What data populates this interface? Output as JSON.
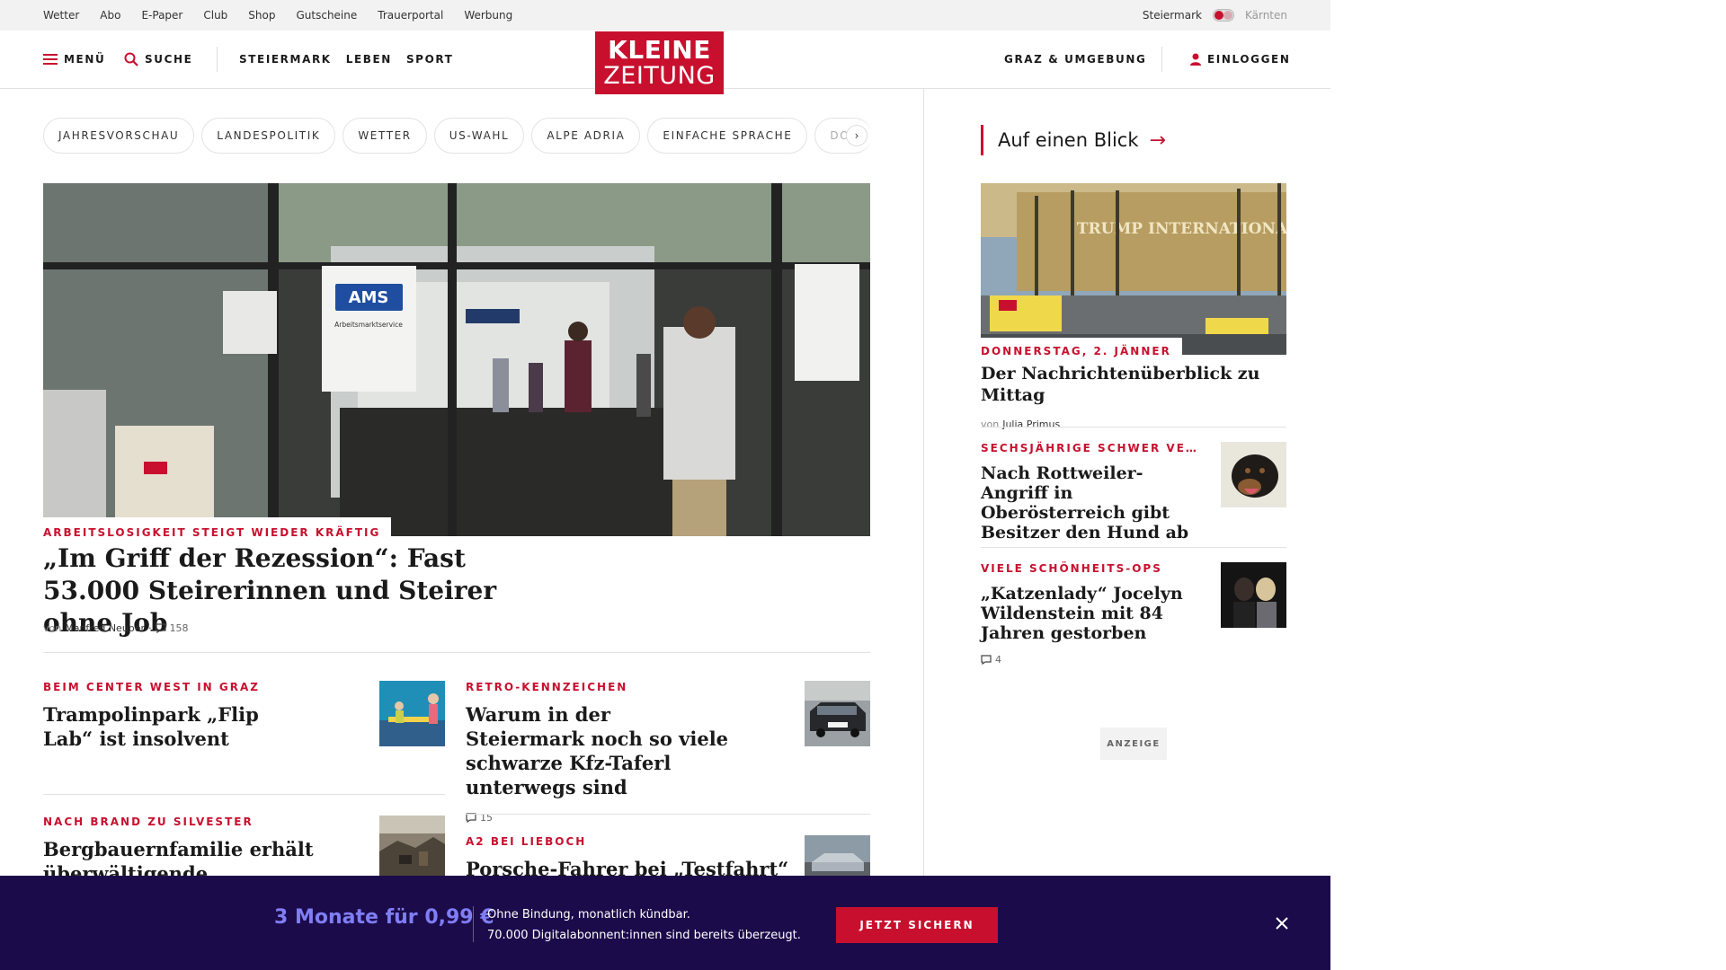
{
  "topbar": {
    "links": [
      "Wetter",
      "Abo",
      "E-Paper",
      "Club",
      "Shop",
      "Gutscheine",
      "Trauerportal",
      "Werbung"
    ],
    "region_active": "Steiermark",
    "region_inactive": "Kärnten"
  },
  "header": {
    "menu_label": "MENÜ",
    "search_label": "SUCHE",
    "nav": [
      "STEIERMARK",
      "LEBEN",
      "SPORT"
    ],
    "logo_line1": "KLEINE",
    "logo_line2": "ZEITUNG",
    "local_label": "GRAZ & UMGEBUNG",
    "login_label": "EINLOGGEN"
  },
  "chips": [
    "JAHRESVORSCHAU",
    "LANDESPOLITIK",
    "WETTER",
    "US-WAHL",
    "ALPE ADRIA",
    "EINFACHE SPRACHE",
    "DOS"
  ],
  "hero": {
    "kicker": "ARBEITSLOSIGKEIT STEIGT WIEDER KRÄFTIG",
    "title": "„Im Griff der Rezession“: Fast 53.000 Steirerinnen und Steirer ohne Job",
    "byline_prefix": "von",
    "author": "Manfred Neuper",
    "comments": "158",
    "image_signs": [
      "AMS",
      "Arbeitsmarktservice"
    ]
  },
  "articles": [
    {
      "kicker": "BEIM CENTER WEST IN GRAZ",
      "title": "Trampolinpark „Flip Lab“ ist insolvent",
      "comments": ""
    },
    {
      "kicker": "RETRO-KENNZEICHEN",
      "title": "Warum in der Steiermark noch so viele schwarze Kfz-Taferl unterwegs sind",
      "comments": "15"
    },
    {
      "kicker": "NACH BRAND ZU SILVESTER",
      "title": "Bergbauernfamilie erhält überwältigende Unterstützung",
      "comments": ""
    },
    {
      "kicker": "A2 BEI LIEBOCH",
      "title": "Porsche-Fahrer bei „Testfahrt“",
      "comments": ""
    }
  ],
  "sidebar": {
    "heading": "Auf einen Blick",
    "main": {
      "kicker": "DONNERSTAG, 2. JÄNNER",
      "title": "Der Nachrichtenüberblick zu Mittag",
      "byline_prefix": "von",
      "author": "Julia Primus",
      "image_sign": "TRUMP INTERNATIONAL"
    },
    "items": [
      {
        "kicker": "SECHSJÄHRIGE SCHWER VE…",
        "title": "Nach Rottweiler-Angriff in Oberösterreich gibt Besitzer den Hund ab",
        "comments": ""
      },
      {
        "kicker": "VIELE SCHÖNHEITS-OPS",
        "title": "„Katzenlady“ Jocelyn Wildenstein mit 84 Jahren gestorben",
        "comments": "4"
      }
    ],
    "ad_label": "ANZEIGE"
  },
  "promo": {
    "price": "3 Monate für 0,99 €",
    "line1": "Ohne Bindung, monatlich kündbar.",
    "line2": "70.000 Digitalabonnent:innen sind bereits überzeugt.",
    "cta": "JETZT SICHERN"
  },
  "colors": {
    "brand_red": "#c8102e",
    "promo_bg": "#1c0b4a",
    "promo_price": "#7f7ef5"
  }
}
